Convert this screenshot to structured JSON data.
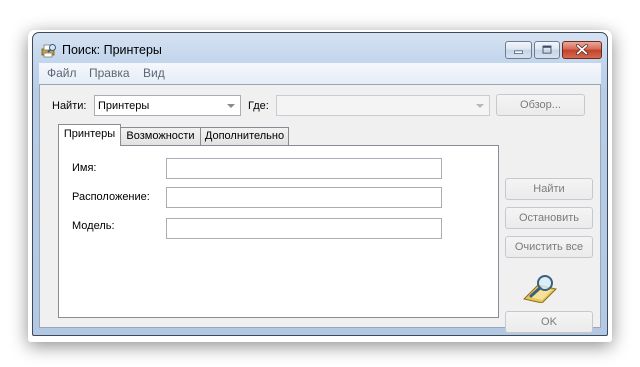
{
  "window": {
    "title": "Поиск: Принтеры",
    "icon": "find-printers-icon"
  },
  "menu": [
    "Файл",
    "Правка",
    "Вид"
  ],
  "find": {
    "label": "Найти:",
    "value": "Принтеры",
    "where_label": "Где:",
    "where_value": "",
    "browse_label": "Обзор..."
  },
  "tabs": [
    {
      "label": "Принтеры",
      "active": true
    },
    {
      "label": "Возможности",
      "active": false
    },
    {
      "label": "Дополнительно",
      "active": false
    }
  ],
  "fields": [
    {
      "label": "Имя:",
      "value": ""
    },
    {
      "label": "Расположение:",
      "value": ""
    },
    {
      "label": "Модель:",
      "value": ""
    }
  ],
  "actions": {
    "find_now": "Найти",
    "stop": "Остановить",
    "clear_all": "Очистить все",
    "ok": "OK"
  },
  "colors": {
    "frame": "#b8cce6",
    "close_button": "#c2402a",
    "disabled_text": "#7b7b7b"
  }
}
